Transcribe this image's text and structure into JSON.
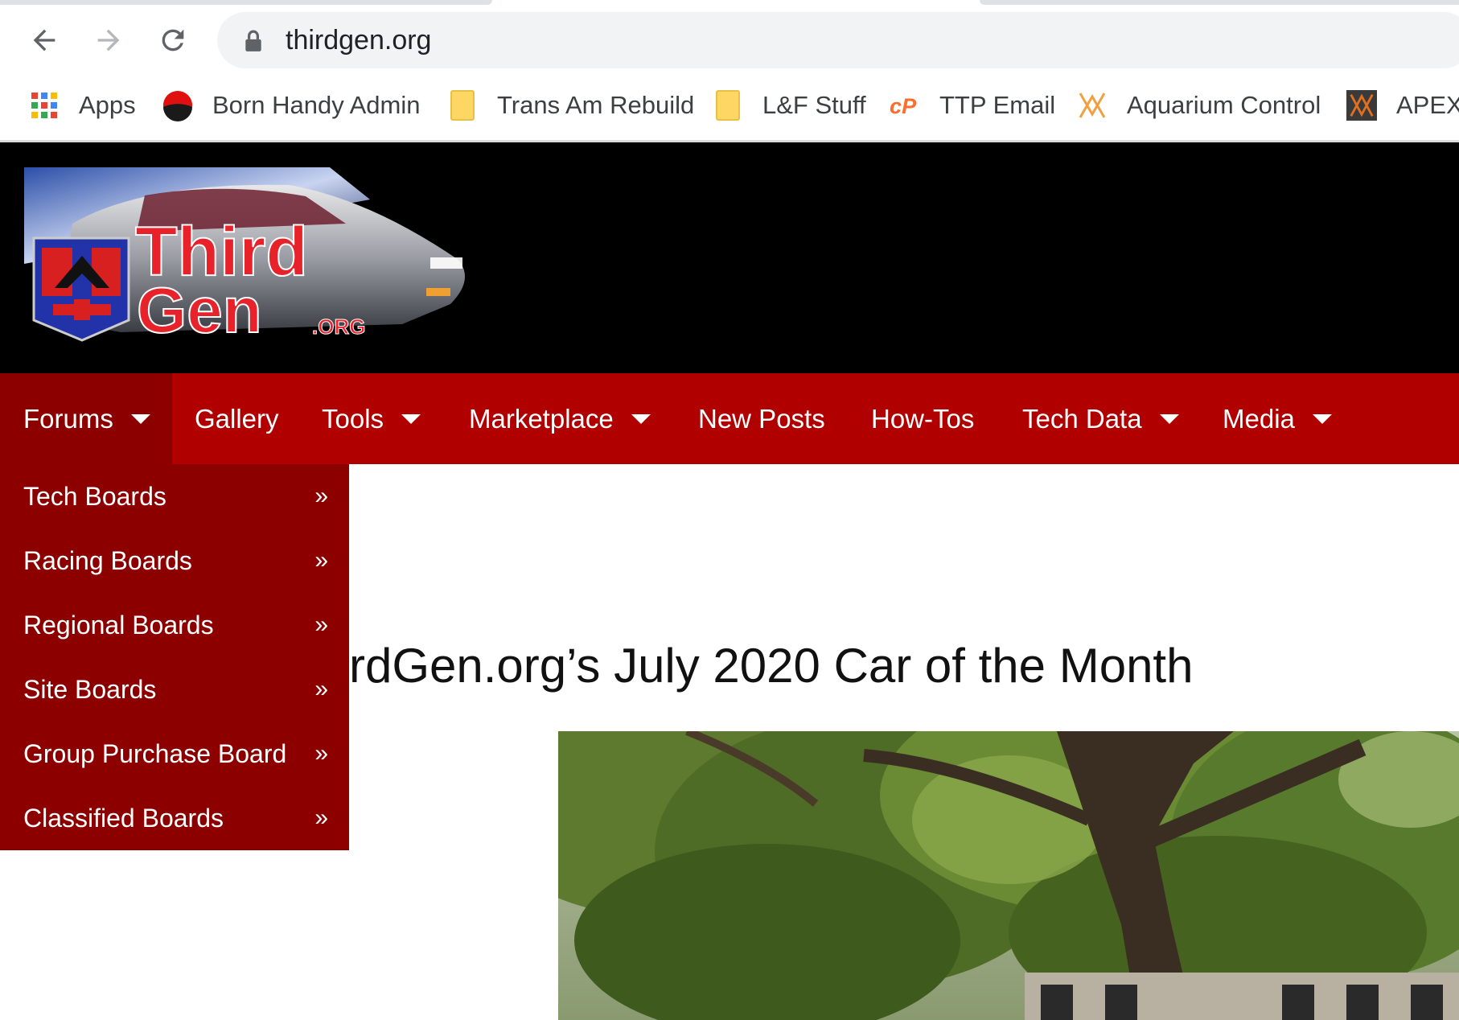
{
  "browser": {
    "url": "thirdgen.org",
    "bookmarks": [
      {
        "label": "Apps",
        "icon": "apps-grid-icon"
      },
      {
        "label": "Born Handy Admin",
        "icon": "born-handy-icon"
      },
      {
        "label": "Trans Am Rebuild",
        "icon": "folder-icon"
      },
      {
        "label": "L&F Stuff",
        "icon": "folder-icon"
      },
      {
        "label": "TTP Email",
        "icon": "cpanel-icon"
      },
      {
        "label": "Aquarium Control",
        "icon": "apex-icon"
      },
      {
        "label": "APEX",
        "icon": "apex-dark-icon"
      }
    ]
  },
  "site": {
    "logo": {
      "line1": "Third",
      "line2": "Gen",
      "suffix": ".ORG"
    },
    "nav": [
      {
        "label": "Forums",
        "has_dropdown": true,
        "active": true
      },
      {
        "label": "Gallery",
        "has_dropdown": false
      },
      {
        "label": "Tools",
        "has_dropdown": true
      },
      {
        "label": "Marketplace",
        "has_dropdown": true
      },
      {
        "label": "New Posts",
        "has_dropdown": false
      },
      {
        "label": "How-Tos",
        "has_dropdown": false
      },
      {
        "label": "Tech Data",
        "has_dropdown": true
      },
      {
        "label": "Media",
        "has_dropdown": true
      }
    ],
    "forums_menu": [
      {
        "label": "Tech Boards",
        "chevron": "»"
      },
      {
        "label": "Racing Boards",
        "chevron": "»"
      },
      {
        "label": "Regional Boards",
        "chevron": "»"
      },
      {
        "label": "Site Boards",
        "chevron": "»"
      },
      {
        "label": "Group Purchase Board",
        "chevron": "»"
      },
      {
        "label": "Classified Boards",
        "chevron": "»"
      }
    ],
    "article_title": "rdGen.org’s July 2020 Car of the Month"
  },
  "colors": {
    "nav_red": "#b00000",
    "nav_dark_red": "#8c0000",
    "header_black": "#000000"
  }
}
